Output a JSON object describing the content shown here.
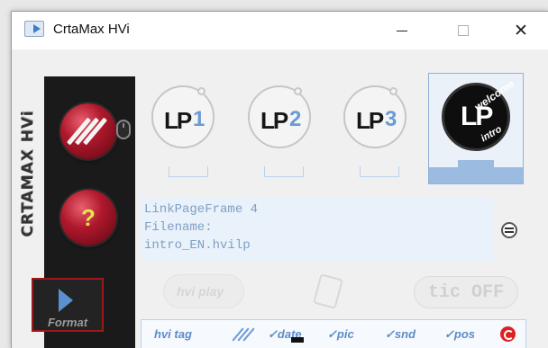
{
  "window": {
    "title": "CrtaMax HVi",
    "minimize_label": "",
    "close_label": "✕"
  },
  "sidebar": {
    "vertical_title": "CRTAMAX HVi",
    "help_label": "?",
    "format_label": "Format"
  },
  "link_pages": [
    {
      "label": "LP",
      "number": "1"
    },
    {
      "label": "LP",
      "number": "2"
    },
    {
      "label": "LP",
      "number": "3"
    }
  ],
  "selected_page": {
    "label": "LP",
    "welcome": "welcome",
    "intro": "intro"
  },
  "info": {
    "line1": "LinkPageFrame 4",
    "line2": "Filename:",
    "line3": "intro_EN.hvilp"
  },
  "controls": {
    "hviplay_label": "hvi play",
    "tic_label": "tic OFF"
  },
  "toolbar": {
    "hvitag": "hvi tag",
    "date": "✓date",
    "pic": "✓pic",
    "snd": "✓snd",
    "pos": "✓pos"
  },
  "colors": {
    "accent": "#5c8cc8",
    "red": "#b0182c",
    "dark": "#1a1a1a"
  }
}
